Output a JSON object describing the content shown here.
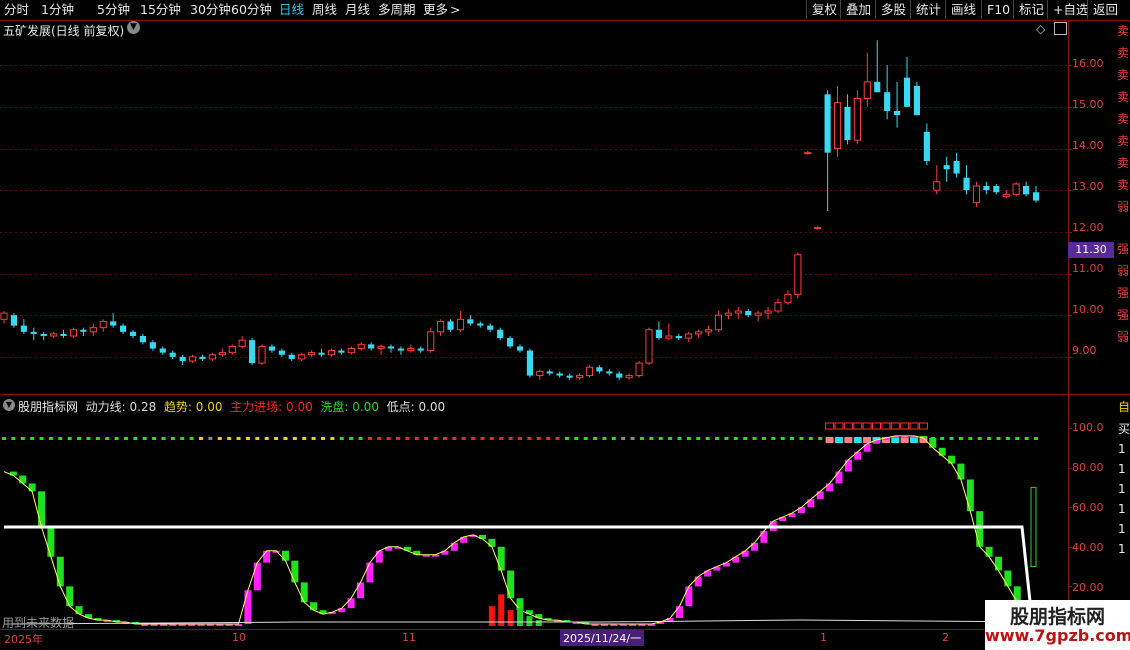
{
  "toolbar": {
    "periods": [
      "分时",
      "1分钟",
      "5分钟",
      "15分钟",
      "30分钟",
      "60分钟",
      "日线",
      "周线",
      "月线",
      "多周期",
      "更多"
    ],
    "active_period": "日线",
    "more_chevron": ">",
    "buttons": [
      "复权",
      "叠加",
      "多股",
      "统计",
      "画线",
      "F10",
      "标记",
      "+自选",
      "返回"
    ]
  },
  "main_chart": {
    "title": "五矿发展(日线 前复权)",
    "price_badge": "11.30",
    "yticks": [
      "16.00",
      "15.00",
      "14.00",
      "13.00",
      "12.00",
      "11.00",
      "10.00",
      "9.00"
    ],
    "side_chars": [
      "卖",
      "卖",
      "卖",
      "卖",
      "卖",
      "卖",
      "卖",
      "卖",
      "弱",
      "强",
      "弱",
      "强",
      "强",
      "弱"
    ]
  },
  "indicator": {
    "name": "股朋指标网",
    "items": [
      {
        "label": "动力线",
        "value": "0.28",
        "color": "#dddddd"
      },
      {
        "label": "趋势",
        "value": "0.00",
        "color": "#f0d000"
      },
      {
        "label": "主力进场",
        "value": "0.00",
        "color": "#ff2020"
      },
      {
        "label": "洗盘",
        "value": "0.00",
        "color": "#20dd20"
      },
      {
        "label": "低点",
        "value": "0.00",
        "color": "#dddddd"
      }
    ],
    "yticks": [
      "100.0",
      "80.00",
      "60.00",
      "40.00",
      "20.00"
    ],
    "side_chars": [
      "自",
      "买",
      "1",
      "1",
      "1",
      "1",
      "1",
      "1"
    ]
  },
  "xaxis": {
    "labels": [
      "2025年",
      "10",
      "11",
      "2025/11/24/一",
      "1",
      "2"
    ]
  },
  "overlay_text": "用到未来数据",
  "watermark": {
    "line1": "股朋指标网",
    "line2": "www.7gpzb.com"
  },
  "colors": {
    "up": "#ff3b3b",
    "down": "#3ad8f0",
    "magenta": "#ff20ff",
    "green": "#20e020",
    "axis": "#8a1010"
  },
  "chart_data": {
    "type": "candlestick",
    "ylim": [
      8.3,
      16.7
    ],
    "candles": [
      [
        9.9,
        10.1,
        9.8,
        10.05
      ],
      [
        10.0,
        10.05,
        9.7,
        9.75
      ],
      [
        9.75,
        9.9,
        9.55,
        9.6
      ],
      [
        9.6,
        9.7,
        9.4,
        9.55
      ],
      [
        9.55,
        9.6,
        9.4,
        9.5
      ],
      [
        9.5,
        9.6,
        9.45,
        9.55
      ],
      [
        9.55,
        9.65,
        9.45,
        9.5
      ],
      [
        9.5,
        9.7,
        9.45,
        9.65
      ],
      [
        9.65,
        9.7,
        9.5,
        9.6
      ],
      [
        9.6,
        9.8,
        9.5,
        9.7
      ],
      [
        9.7,
        9.9,
        9.6,
        9.85
      ],
      [
        9.85,
        10.05,
        9.7,
        9.75
      ],
      [
        9.75,
        9.8,
        9.55,
        9.6
      ],
      [
        9.6,
        9.65,
        9.45,
        9.5
      ],
      [
        9.5,
        9.55,
        9.3,
        9.35
      ],
      [
        9.35,
        9.4,
        9.15,
        9.2
      ],
      [
        9.2,
        9.25,
        9.05,
        9.1
      ],
      [
        9.1,
        9.15,
        8.95,
        9.0
      ],
      [
        9.0,
        9.05,
        8.8,
        8.9
      ],
      [
        8.9,
        9.05,
        8.85,
        9.0
      ],
      [
        9.0,
        9.05,
        8.9,
        8.95
      ],
      [
        8.95,
        9.1,
        8.9,
        9.05
      ],
      [
        9.05,
        9.2,
        9.0,
        9.1
      ],
      [
        9.1,
        9.3,
        9.05,
        9.25
      ],
      [
        9.25,
        9.5,
        9.2,
        9.4
      ],
      [
        9.4,
        9.45,
        8.8,
        8.85
      ],
      [
        8.85,
        9.3,
        8.8,
        9.25
      ],
      [
        9.25,
        9.3,
        9.1,
        9.15
      ],
      [
        9.15,
        9.2,
        9.0,
        9.05
      ],
      [
        9.05,
        9.1,
        8.9,
        8.95
      ],
      [
        8.95,
        9.1,
        8.9,
        9.05
      ],
      [
        9.05,
        9.15,
        9.0,
        9.1
      ],
      [
        9.1,
        9.2,
        9.0,
        9.05
      ],
      [
        9.05,
        9.2,
        9.0,
        9.15
      ],
      [
        9.15,
        9.2,
        9.05,
        9.1
      ],
      [
        9.1,
        9.25,
        9.05,
        9.2
      ],
      [
        9.2,
        9.35,
        9.15,
        9.3
      ],
      [
        9.3,
        9.35,
        9.15,
        9.2
      ],
      [
        9.2,
        9.3,
        9.05,
        9.25
      ],
      [
        9.25,
        9.3,
        9.1,
        9.2
      ],
      [
        9.2,
        9.25,
        9.05,
        9.15
      ],
      [
        9.15,
        9.3,
        9.1,
        9.2
      ],
      [
        9.2,
        9.25,
        9.1,
        9.15
      ],
      [
        9.15,
        9.7,
        9.1,
        9.6
      ],
      [
        9.6,
        9.9,
        9.5,
        9.85
      ],
      [
        9.85,
        9.9,
        9.6,
        9.65
      ],
      [
        9.65,
        10.1,
        9.6,
        9.9
      ],
      [
        9.9,
        10.0,
        9.75,
        9.8
      ],
      [
        9.8,
        9.85,
        9.7,
        9.75
      ],
      [
        9.75,
        9.8,
        9.6,
        9.65
      ],
      [
        9.65,
        9.7,
        9.4,
        9.45
      ],
      [
        9.45,
        9.5,
        9.2,
        9.25
      ],
      [
        9.25,
        9.3,
        9.1,
        9.15
      ],
      [
        9.15,
        9.2,
        8.5,
        8.55
      ],
      [
        8.55,
        8.7,
        8.45,
        8.65
      ],
      [
        8.65,
        8.7,
        8.55,
        8.6
      ],
      [
        8.6,
        8.65,
        8.5,
        8.55
      ],
      [
        8.55,
        8.6,
        8.45,
        8.5
      ],
      [
        8.5,
        8.6,
        8.45,
        8.55
      ],
      [
        8.55,
        8.8,
        8.5,
        8.75
      ],
      [
        8.75,
        8.8,
        8.6,
        8.65
      ],
      [
        8.65,
        8.7,
        8.55,
        8.6
      ],
      [
        8.6,
        8.65,
        8.45,
        8.5
      ],
      [
        8.5,
        8.6,
        8.45,
        8.55
      ],
      [
        8.55,
        8.9,
        8.5,
        8.85
      ],
      [
        8.85,
        9.7,
        8.8,
        9.65
      ],
      [
        9.65,
        9.85,
        9.4,
        9.45
      ],
      [
        9.45,
        9.8,
        9.4,
        9.5
      ],
      [
        9.5,
        9.55,
        9.4,
        9.45
      ],
      [
        9.45,
        9.6,
        9.35,
        9.55
      ],
      [
        9.55,
        9.65,
        9.45,
        9.6
      ],
      [
        9.6,
        9.75,
        9.5,
        9.65
      ],
      [
        9.65,
        10.1,
        9.6,
        10.0
      ],
      [
        10.0,
        10.15,
        9.9,
        10.05
      ],
      [
        10.05,
        10.2,
        9.9,
        10.1
      ],
      [
        10.1,
        10.15,
        9.95,
        10.0
      ],
      [
        10.0,
        10.1,
        9.85,
        10.05
      ],
      [
        10.05,
        10.2,
        9.9,
        10.1
      ],
      [
        10.1,
        10.4,
        10.05,
        10.3
      ],
      [
        10.3,
        10.6,
        10.25,
        10.5
      ],
      [
        10.5,
        11.5,
        10.4,
        11.45
      ],
      [
        13.9,
        13.95,
        13.85,
        13.9
      ],
      [
        12.1,
        12.15,
        12.05,
        12.1
      ],
      [
        15.3,
        15.4,
        12.5,
        13.9
      ],
      [
        14.0,
        15.5,
        13.8,
        15.1
      ],
      [
        15.0,
        15.3,
        14.1,
        14.2
      ],
      [
        14.2,
        15.4,
        14.1,
        15.2
      ],
      [
        15.2,
        16.3,
        15.0,
        15.6
      ],
      [
        15.6,
        16.6,
        15.4,
        15.35
      ],
      [
        15.35,
        16.0,
        14.7,
        14.9
      ],
      [
        14.9,
        15.6,
        14.5,
        14.8
      ],
      [
        15.7,
        16.2,
        15.0,
        15.0
      ],
      [
        15.5,
        15.6,
        14.8,
        14.8
      ],
      [
        14.4,
        14.6,
        13.6,
        13.7
      ],
      [
        13.0,
        13.6,
        12.9,
        13.2
      ],
      [
        13.6,
        13.8,
        13.2,
        13.5
      ],
      [
        13.7,
        13.9,
        13.3,
        13.4
      ],
      [
        13.3,
        13.6,
        12.9,
        13.0
      ],
      [
        12.7,
        13.2,
        12.6,
        13.1
      ],
      [
        13.1,
        13.2,
        12.9,
        13.0
      ],
      [
        13.1,
        13.15,
        12.9,
        12.95
      ],
      [
        12.85,
        13.0,
        12.8,
        12.9
      ],
      [
        12.9,
        13.2,
        12.85,
        13.15
      ],
      [
        13.1,
        13.2,
        12.85,
        12.9
      ],
      [
        12.95,
        13.1,
        12.7,
        12.75
      ]
    ],
    "indicator_series": {
      "name": "动力线",
      "ylim": [
        0,
        105
      ],
      "values": [
        78,
        76,
        72,
        68,
        50,
        35,
        20,
        10,
        6,
        4,
        3,
        3,
        2,
        2,
        1,
        1,
        1,
        1,
        1,
        1,
        1,
        1,
        1,
        1,
        1,
        1,
        18,
        32,
        38,
        38,
        33,
        22,
        12,
        8,
        6,
        7,
        9,
        14,
        22,
        32,
        38,
        40,
        40,
        38,
        36,
        36,
        36,
        38,
        42,
        45,
        46,
        44,
        40,
        28,
        14,
        8,
        6,
        4,
        3,
        3,
        2,
        2,
        1,
        1,
        1,
        1,
        1,
        1,
        1,
        1,
        2,
        4,
        10,
        20,
        25,
        28,
        30,
        32,
        35,
        38,
        42,
        48,
        53,
        55,
        57,
        60,
        64,
        68,
        72,
        78,
        84,
        88,
        92,
        94,
        95,
        96,
        96,
        96,
        95,
        90,
        86,
        82,
        74,
        58,
        40,
        35,
        28,
        20,
        12,
        6,
        2
      ],
      "white_line_level": 50
    }
  }
}
